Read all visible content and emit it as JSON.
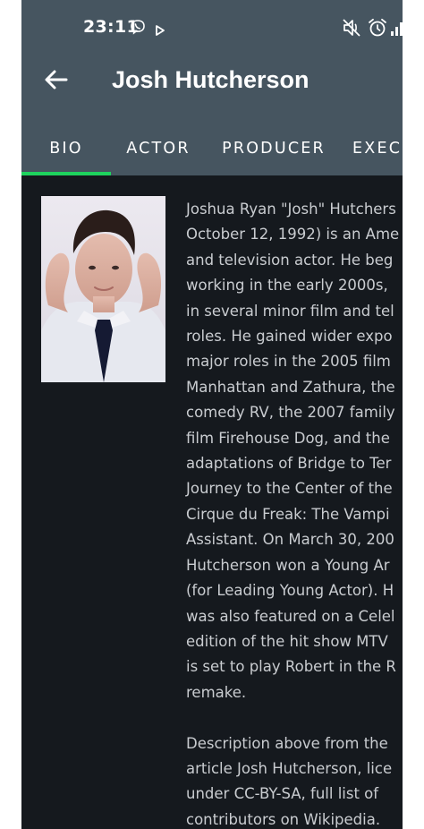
{
  "status_bar": {
    "time": "23:11",
    "icons": [
      "viber-icon",
      "play-icon",
      "mute-icon",
      "alarm-icon",
      "signal-icon"
    ]
  },
  "app_bar": {
    "back_icon": "arrow-left-icon",
    "title": "Josh Hutcherson"
  },
  "tabs": [
    {
      "label": "BIO",
      "selected": true
    },
    {
      "label": "ACTOR",
      "selected": false
    },
    {
      "label": "PRODUCER",
      "selected": false
    },
    {
      "label": "EXEC",
      "selected": false
    }
  ],
  "bio": {
    "photo_alt": "Josh Hutcherson portrait",
    "paragraph_1_lines": [
      "Joshua Ryan \"Josh\" Hutchers",
      "October 12, 1992) is an Ame",
      "and television actor. He beg",
      "working in the early 2000s, ",
      "in several minor film and tel",
      "roles. He gained wider expo",
      "major roles in the 2005 film",
      "Manhattan and Zathura, the",
      "comedy RV, the 2007 family",
      "film Firehouse Dog, and the",
      "adaptations of Bridge to Ter",
      "Journey to the Center of the",
      "Cirque du Freak: The Vampi",
      "Assistant. On March 30, 200",
      "Hutcherson won a Young Ar",
      "(for Leading Young Actor). H",
      "was also featured on a Celel",
      "edition of the hit show MTV",
      "is set to play Robert in the R",
      "remake."
    ],
    "paragraph_2_lines": [
      "Description above from the",
      "article Josh Hutcherson, lice",
      "under CC-BY-SA, full list of",
      "contributors on Wikipedia."
    ]
  },
  "colors": {
    "header_bg": "#465560",
    "content_bg": "#15191e",
    "accent": "#1ed35e",
    "text_primary": "#ffffff",
    "text_body": "#c9ccd0"
  }
}
